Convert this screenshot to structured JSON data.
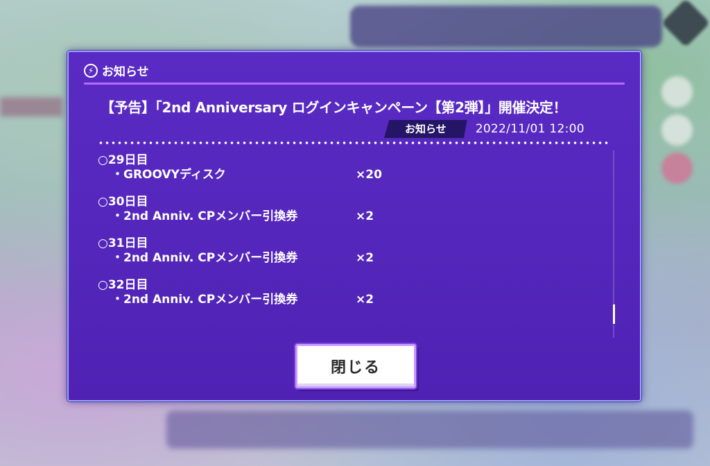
{
  "dialog": {
    "header_title": "お知らせ",
    "notice_title": "【予告】「2nd Anniversary ログインキャンペーン【第2弾】」開催決定！",
    "category": "お知らせ",
    "date": "2022/11/01 12:00",
    "close_label": "閉じる"
  },
  "rewards": [
    {
      "day": "○29日目",
      "item": "・GROOVYディスク",
      "qty": "×20"
    },
    {
      "day": "○30日目",
      "item": "・2nd Anniv. CPメンバー引換券",
      "qty": "×2"
    },
    {
      "day": "○31日目",
      "item": "・2nd Anniv. CPメンバー引換券",
      "qty": "×2"
    },
    {
      "day": "○32日目",
      "item": "・2nd Anniv. CPメンバー引換券",
      "qty": "×2"
    }
  ],
  "icons": {
    "header": "lightning-bolt-icon"
  },
  "colors": {
    "dialog_bg": "#5a2bc4",
    "accent_line": "#b86bff",
    "tag_bg": "#251566",
    "border": "#9aa8ff"
  }
}
